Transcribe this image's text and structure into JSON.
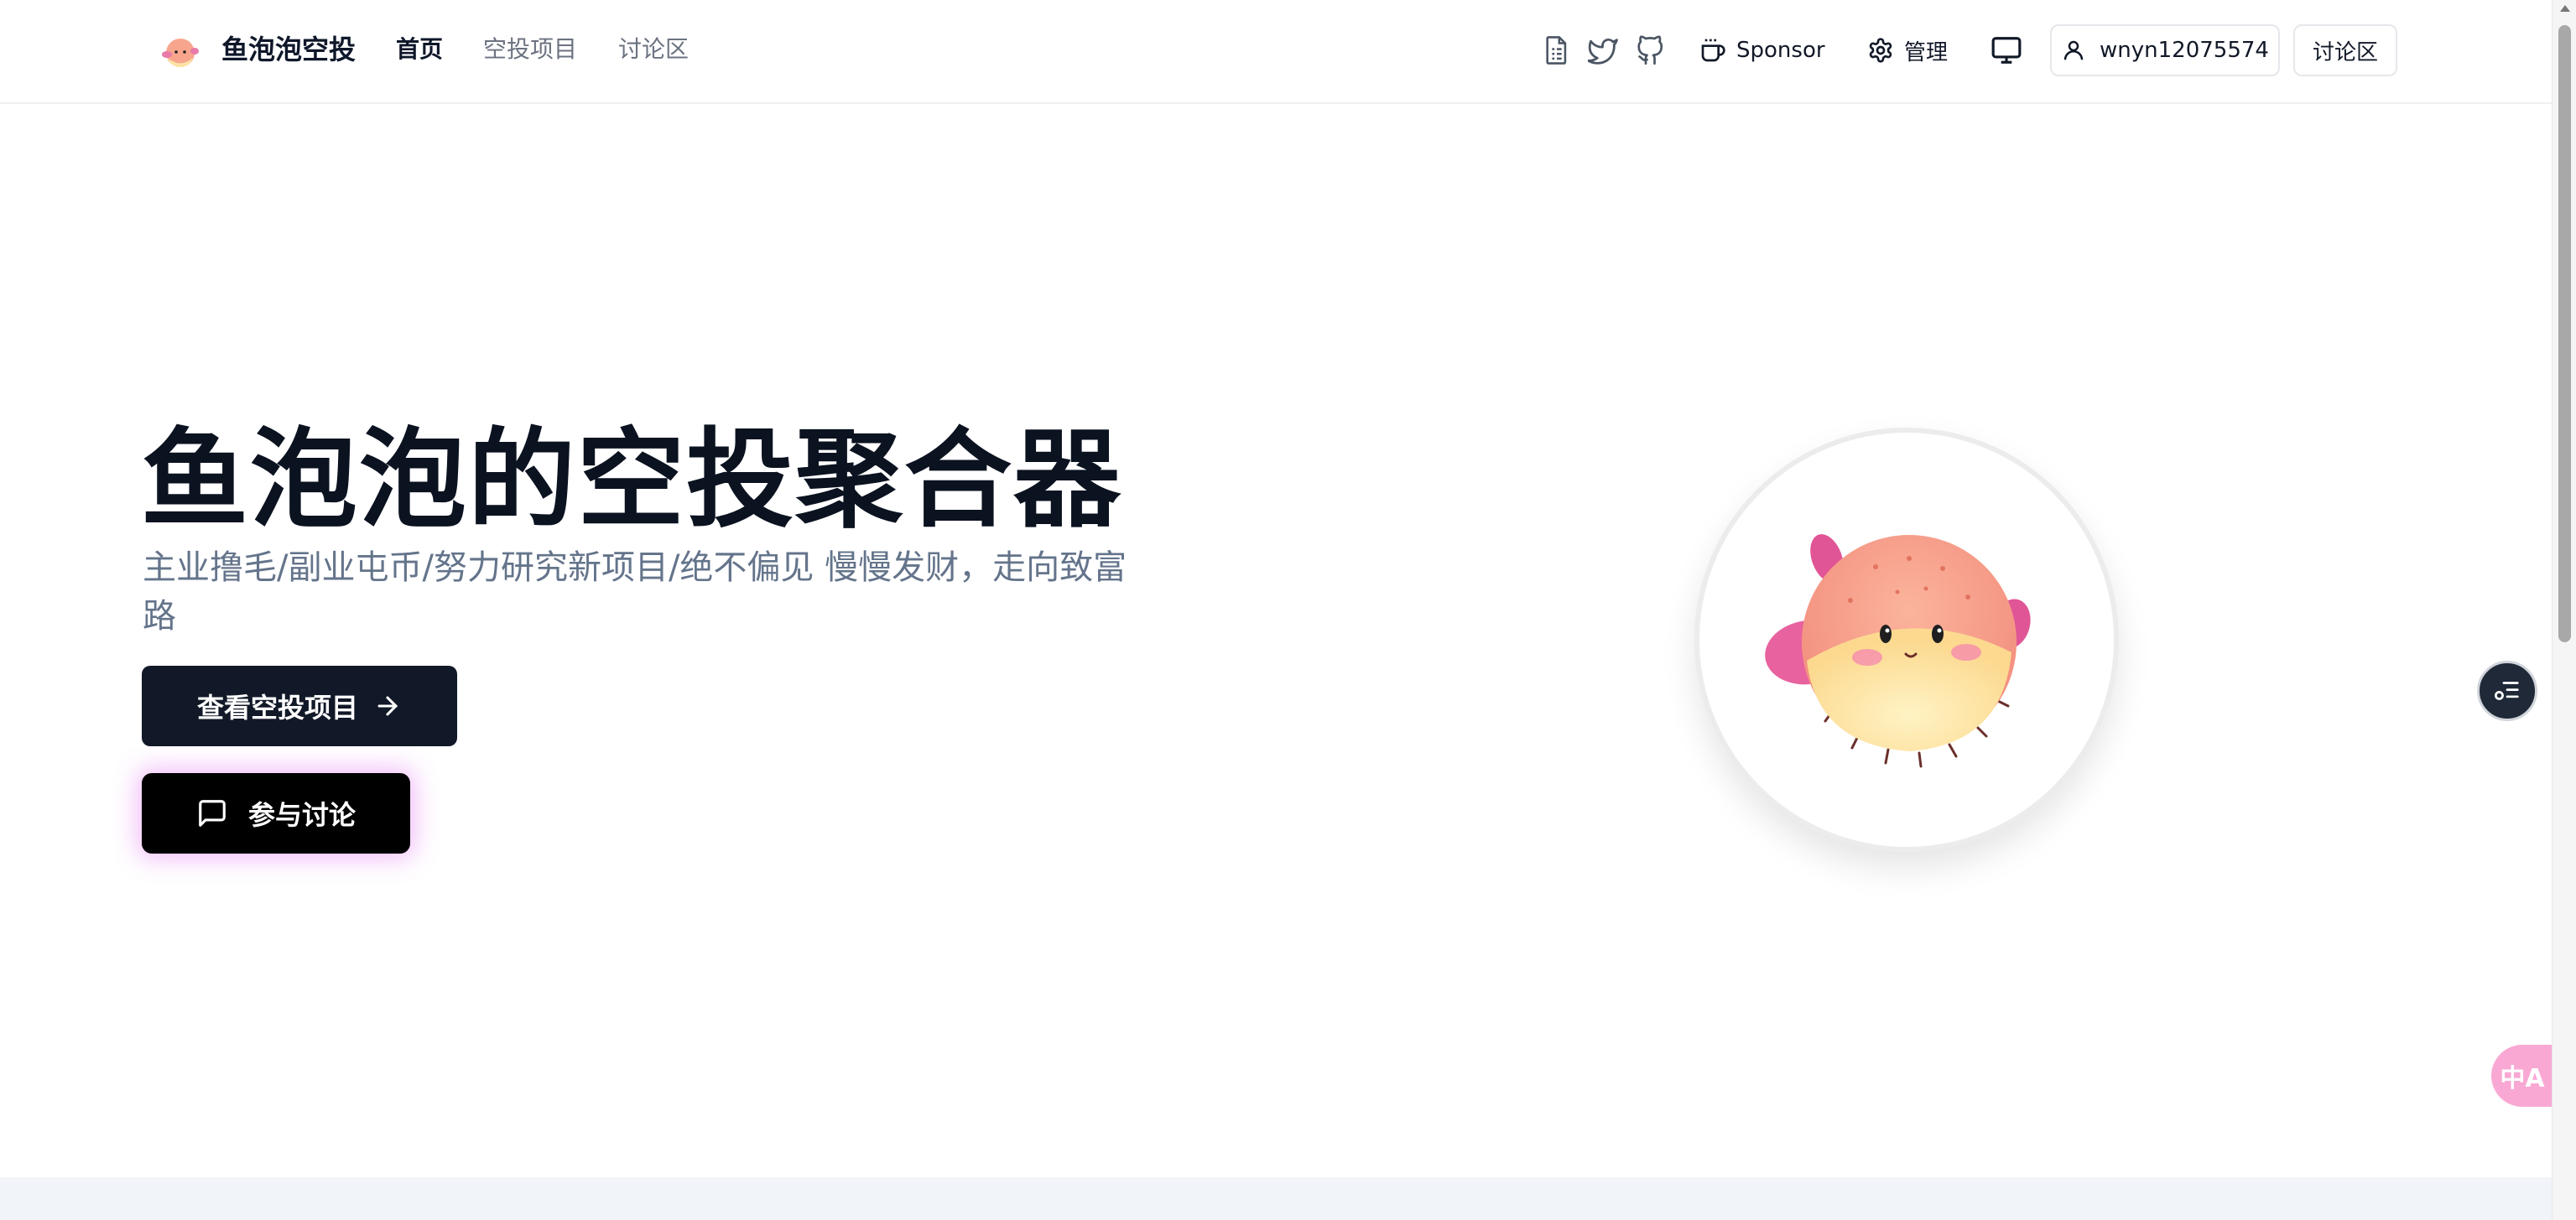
{
  "header": {
    "brand": "鱼泡泡空投",
    "nav": [
      {
        "label": "首页",
        "active": true
      },
      {
        "label": "空投项目",
        "active": false
      },
      {
        "label": "讨论区",
        "active": false
      }
    ],
    "icons": [
      "document-icon",
      "twitter-icon",
      "github-icon"
    ],
    "sponsor_label": "Sponsor",
    "admin_label": "管理",
    "user_label": "wnyn12075574",
    "discuss_label": "讨论区"
  },
  "hero": {
    "title": "鱼泡泡的空投聚合器",
    "subtitle": "主业撸毛/副业屯币/努力研究新项目/绝不偏见 慢慢发财，走向致富路",
    "primary_button": "查看空投项目",
    "discuss_button": "参与讨论"
  },
  "widgets": {
    "translate_glyph": "中A"
  },
  "colors": {
    "primary": "#111827",
    "discuss_glow": "#d946ef",
    "muted_text": "#64748b",
    "translate_bg": "#f9a8d4"
  }
}
